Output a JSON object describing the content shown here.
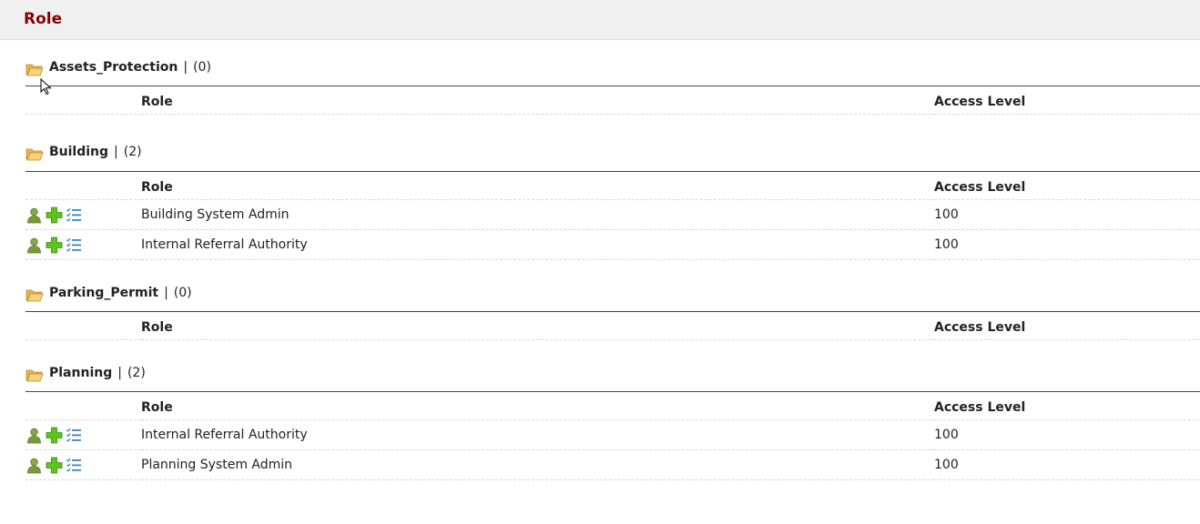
{
  "header": {
    "title": "Role"
  },
  "columns": {
    "role": "Role",
    "access_level": "Access Level"
  },
  "groups": [
    {
      "name": "Assets_Protection",
      "separator": "|",
      "count": "(0)",
      "rows": []
    },
    {
      "name": "Building",
      "separator": "|",
      "count": "(2)",
      "rows": [
        {
          "role": "Building System Admin",
          "access_level": "100"
        },
        {
          "role": "Internal Referral Authority",
          "access_level": "100"
        }
      ]
    },
    {
      "name": "Parking_Permit",
      "separator": "|",
      "count": "(0)",
      "rows": []
    },
    {
      "name": "Planning",
      "separator": "|",
      "count": "(2)",
      "rows": [
        {
          "role": "Internal Referral Authority",
          "access_level": "100"
        },
        {
          "role": "Planning System Admin",
          "access_level": "100"
        }
      ]
    }
  ],
  "icons": {
    "folder": "folder-open-icon",
    "user": "user-icon",
    "add": "add-icon",
    "list": "checklist-icon"
  },
  "colors": {
    "title": "#8b0000",
    "header_bg": "#f0f0f0",
    "folder": "#f3c768",
    "user": "#7a9a3a",
    "add": "#58c21a",
    "list": "#3d86c6"
  }
}
